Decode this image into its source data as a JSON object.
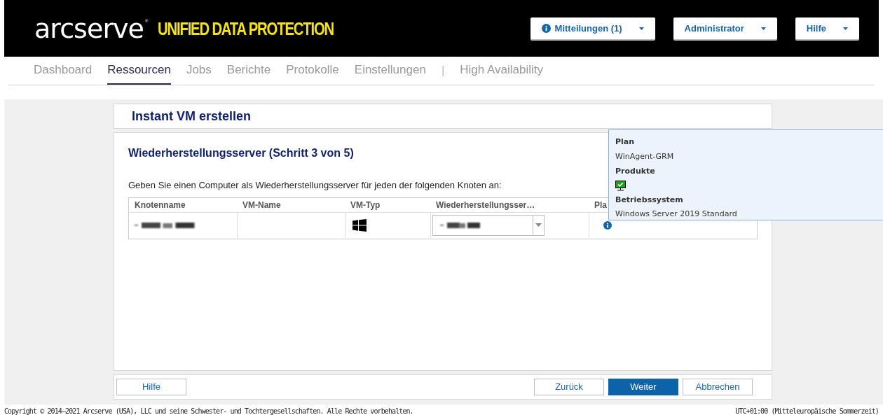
{
  "header": {
    "logo": "arcserve",
    "logo_mark": "®",
    "product": "UNIFIED DATA PROTECTION",
    "menus": [
      {
        "label": "Mitteilungen (1)",
        "info": true
      },
      {
        "label": "Administrator",
        "info": false
      },
      {
        "label": "Hilfe",
        "info": false
      }
    ]
  },
  "nav": [
    {
      "label": "Dashboard",
      "selected": false
    },
    {
      "label": "Ressourcen",
      "selected": true
    },
    {
      "label": "Jobs",
      "selected": false
    },
    {
      "label": "Berichte",
      "selected": false
    },
    {
      "label": "Protokolle",
      "selected": false
    },
    {
      "label": "Einstellungen",
      "selected": false
    },
    {
      "label": "High Availability",
      "selected": false
    }
  ],
  "nav_separator": "|",
  "page_title": "Instant VM erstellen",
  "step_title": "Wiederherstellungsserver (Schritt 3 von 5)",
  "instruction": "Geben Sie einen Computer als Wiederherstellungsserver für jeden der folgenden Knoten an:",
  "table": {
    "columns": [
      "Knotenname",
      "VM-Name",
      "VM-Typ",
      "Wiederherstellungsser…",
      "Pla"
    ]
  },
  "tooltip": {
    "sections": [
      {
        "heading": "Plan",
        "kind": "text",
        "value": "WinAgent-GRM"
      },
      {
        "heading": "Produkte",
        "kind": "icon"
      },
      {
        "heading": "Betriebssystem",
        "kind": "text",
        "value": "Windows Server 2019 Standard"
      }
    ]
  },
  "footer_buttons": [
    {
      "label": "Hilfe",
      "primary": false
    },
    {
      "label": "Zurück",
      "primary": false
    },
    {
      "label": "Weiter",
      "primary": true
    },
    {
      "label": "Abbrechen",
      "primary": false
    }
  ],
  "status_bar": {
    "copyright": "Copyright © 2014–2021 Arcserve (USA), LLC und seine Schwester- und Tochtergesellschaften. Alle Rechte vorbehalten.",
    "timezone": "UTC+01:00 (Mitteleuropäische Sommerzeit)"
  }
}
